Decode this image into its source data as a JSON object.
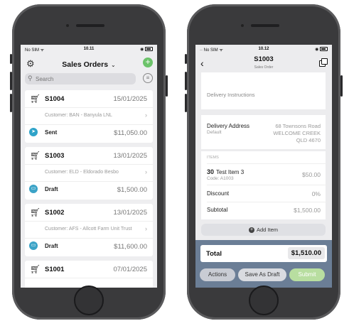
{
  "left_phone": {
    "status": {
      "carrier": "No SIM",
      "time": "10.11"
    },
    "nav": {
      "title": "Sales Orders"
    },
    "search": {
      "placeholder": "Search"
    },
    "orders": [
      {
        "number": "S1004",
        "date": "15/01/2025",
        "customer": "Customer: BAN - Banyula LNL",
        "status": "Sent",
        "amount": "$11,050.00",
        "status_icon": "paper-plane-icon"
      },
      {
        "number": "S1003",
        "date": "13/01/2025",
        "customer": "Customer: ELD - Eldorado Besbo",
        "status": "Draft",
        "amount": "$1,500.00",
        "status_icon": "draft-tray-icon"
      },
      {
        "number": "S1002",
        "date": "13/01/2025",
        "customer": "Customer: AFS - Allcott Farm Unit Trust",
        "status": "Draft",
        "amount": "$11,600.00",
        "status_icon": "draft-tray-icon"
      },
      {
        "number": "S1001",
        "date": "07/01/2025"
      }
    ]
  },
  "right_phone": {
    "status": {
      "carrier": "No SIM",
      "time": "10.12"
    },
    "nav": {
      "title": "S1003",
      "subtitle": "Sales Order"
    },
    "delivery_instructions_label": "Delivery Instructions",
    "delivery_address": {
      "label": "Delivery Address",
      "sub": "Default",
      "lines": [
        "68 Townsons Road",
        "WELCOME CREEK",
        "QLD 4670"
      ]
    },
    "items_header": "ITEMS",
    "item": {
      "qty": "30",
      "name": "Test Item 3",
      "code": "Code: A1003",
      "price": "$50.00"
    },
    "discount": {
      "label": "Discount",
      "value": "0%"
    },
    "subtotal": {
      "label": "Subtotal",
      "value": "$1,500.00"
    },
    "add_item_label": "Add Item",
    "total": {
      "label": "Total",
      "value": "$1,510.00"
    },
    "buttons": {
      "actions": "Actions",
      "save_draft": "Save As Draft",
      "submit": "Submit"
    }
  },
  "colors": {
    "accent_green": "#6cc36a",
    "sent_blue": "#2fa3c9",
    "footer": "#6b7e96",
    "submit": "#b8dea0"
  }
}
